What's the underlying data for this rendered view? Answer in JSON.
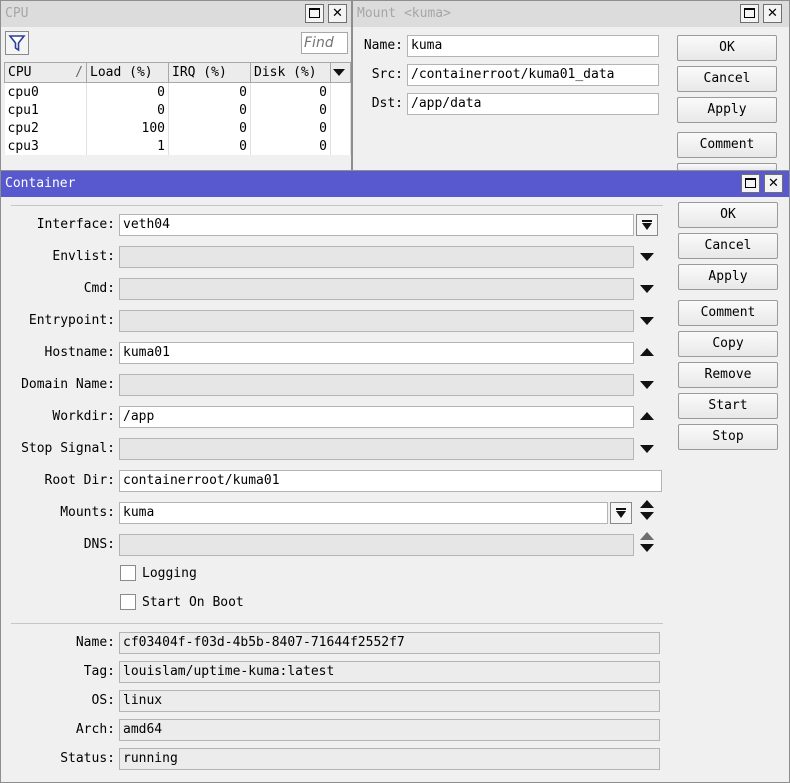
{
  "cpu_window": {
    "title": "CPU",
    "find_placeholder": "Find",
    "columns": [
      "CPU",
      "Load (%)",
      "IRQ (%)",
      "Disk (%)"
    ],
    "rows": [
      {
        "cpu": "cpu0",
        "load": "0",
        "irq": "0",
        "disk": "0"
      },
      {
        "cpu": "cpu1",
        "load": "0",
        "irq": "0",
        "disk": "0"
      },
      {
        "cpu": "cpu2",
        "load": "100",
        "irq": "0",
        "disk": "0"
      },
      {
        "cpu": "cpu3",
        "load": "1",
        "irq": "0",
        "disk": "0"
      }
    ]
  },
  "mount_window": {
    "title": "Mount <kuma>",
    "labels": {
      "name": "Name:",
      "src": "Src:",
      "dst": "Dst:"
    },
    "values": {
      "name": "kuma",
      "src": "/containerroot/kuma01_data",
      "dst": "/app/data"
    },
    "buttons": {
      "ok": "OK",
      "cancel": "Cancel",
      "apply": "Apply",
      "comment": "Comment"
    }
  },
  "container_window": {
    "title": "Container",
    "labels": {
      "interface": "Interface:",
      "envlist": "Envlist:",
      "cmd": "Cmd:",
      "entrypoint": "Entrypoint:",
      "hostname": "Hostname:",
      "domain_name": "Domain Name:",
      "workdir": "Workdir:",
      "stop_signal": "Stop Signal:",
      "root_dir": "Root Dir:",
      "mounts": "Mounts:",
      "dns": "DNS:",
      "name": "Name:",
      "tag": "Tag:",
      "os": "OS:",
      "arch": "Arch:",
      "status": "Status:"
    },
    "values": {
      "interface": "veth04",
      "envlist": "",
      "cmd": "",
      "entrypoint": "",
      "hostname": "kuma01",
      "domain_name": "",
      "workdir": "/app",
      "stop_signal": "",
      "root_dir": "containerroot/kuma01",
      "mounts": "kuma",
      "dns": "",
      "name": "cf03404f-f03d-4b5b-8407-71644f2552f7",
      "tag": "louislam/uptime-kuma:latest",
      "os": "linux",
      "arch": "amd64",
      "status": "running"
    },
    "checkboxes": {
      "logging": "Logging",
      "start_on_boot": "Start On Boot"
    },
    "buttons": {
      "ok": "OK",
      "cancel": "Cancel",
      "apply": "Apply",
      "comment": "Comment",
      "copy": "Copy",
      "remove": "Remove",
      "start": "Start",
      "stop": "Stop"
    }
  }
}
